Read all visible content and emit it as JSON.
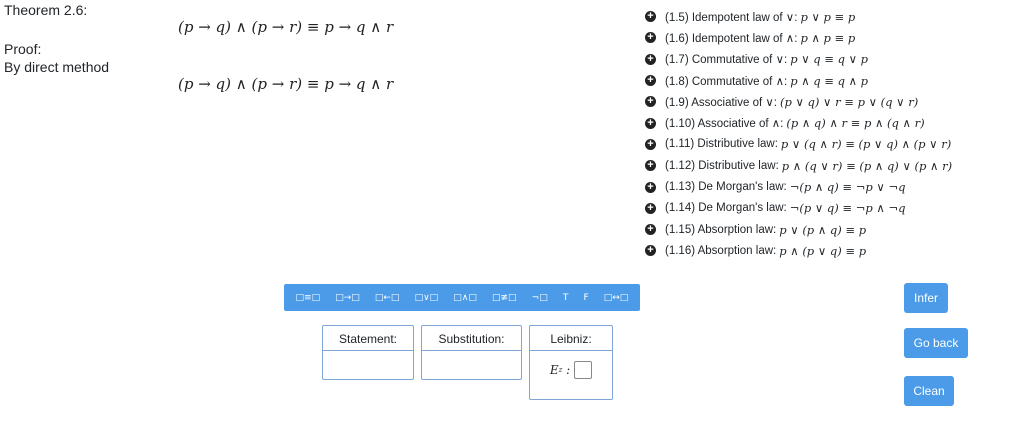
{
  "theorem": {
    "title": "Theorem 2.6:",
    "proof_label": "Proof:",
    "method": "By direct method"
  },
  "formulas": [
    "(p → q) ∧ (p → r) ≡ p → q ∧ r",
    "(p → q) ∧ (p → r) ≡ p → q ∧ r"
  ],
  "laws": [
    {
      "name": "(1.5) Idempotent law of ∨:",
      "expr": "p ∨ p ≡ p"
    },
    {
      "name": "(1.6) Idempotent law of ∧:",
      "expr": "p ∧ p ≡ p"
    },
    {
      "name": "(1.7) Commutative of ∨:",
      "expr": "p ∨ q ≡ q ∨ p"
    },
    {
      "name": "(1.8) Commutative of ∧:",
      "expr": "p ∧ q ≡ q ∧ p"
    },
    {
      "name": "(1.9) Associative of ∨:",
      "expr": "(p ∨ q) ∨ r ≡ p ∨ (q ∨ r)"
    },
    {
      "name": "(1.10) Associative of ∧:",
      "expr": "(p ∧ q) ∧ r ≡ p ∧ (q ∧ r)"
    },
    {
      "name": "(1.11) Distributive law:",
      "expr": "p ∨ (q ∧ r) ≡ (p ∨ q) ∧ (p ∨ r)"
    },
    {
      "name": "(1.12) Distributive law:",
      "expr": "p ∧ (q ∨ r) ≡ (p ∧ q) ∨ (p ∧ r)"
    },
    {
      "name": "(1.13) De Morgan's law:",
      "expr": "¬(p ∧ q) ≡ ¬p ∨ ¬q"
    },
    {
      "name": "(1.14) De Morgan's law:",
      "expr": "¬(p ∨ q) ≡ ¬p ∧ ¬q"
    },
    {
      "name": "(1.15) Absorption law:",
      "expr": "p ∨ (p ∧ q) ≡ p"
    },
    {
      "name": "(1.16) Absorption law:",
      "expr": "p ∧ (p ∨ q) ≡ p"
    }
  ],
  "symbols": [
    "□≡□",
    "□→□",
    "□←□",
    "□∨□",
    "□∧□",
    "□≢□",
    "¬□",
    "T",
    "F",
    "□↔□"
  ],
  "panels": {
    "statement": "Statement:",
    "substitution": "Substitution:",
    "leibniz": "Leibniz:",
    "leibniz_expr": "E"
  },
  "buttons": {
    "infer": "Infer",
    "go_back": "Go back",
    "clean": "Clean"
  },
  "colors": {
    "accent": "#4b9be8",
    "border": "#7ea6d6"
  }
}
